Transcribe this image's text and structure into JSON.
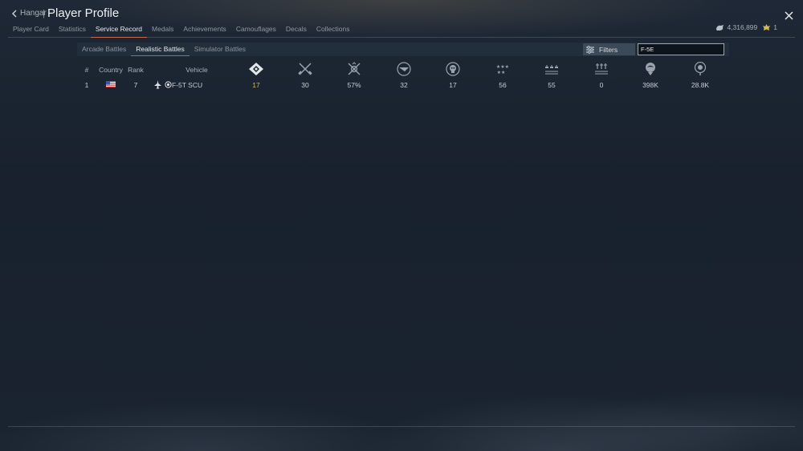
{
  "header": {
    "back_label": "Hangar",
    "separator": "|",
    "title": "Player Profile"
  },
  "tabs": [
    {
      "label": "Player Card"
    },
    {
      "label": "Statistics"
    },
    {
      "label": "Service Record",
      "active": true
    },
    {
      "label": "Medals"
    },
    {
      "label": "Achievements"
    },
    {
      "label": "Camouflages"
    },
    {
      "label": "Decals"
    },
    {
      "label": "Collections"
    }
  ],
  "currency": {
    "silver_lions": "4,316,899",
    "golden_eagles": "1"
  },
  "modes": [
    {
      "label": "Arcade Battles"
    },
    {
      "label": "Realistic Battles",
      "active": true
    },
    {
      "label": "Simulator Battles"
    }
  ],
  "filters": {
    "label": "Filters",
    "search_value": "F-5E"
  },
  "table": {
    "headers": {
      "index": "#",
      "country": "Country",
      "rank": "Rank",
      "vehicle": "Vehicle"
    },
    "stat_icons": [
      "victories-icon",
      "battles-icon",
      "win-rate-icon",
      "respawns-icon",
      "deaths-icon",
      "air-kills-icon",
      "ground-kills-icon",
      "naval-kills-icon",
      "experience-icon",
      "lions-icon"
    ],
    "rows": [
      {
        "index": "1",
        "country": "usa-flag-icon",
        "rank": "7",
        "vehicle_type": "jet-fighter-icon",
        "vehicle_role": "premium-marker-icon",
        "vehicle": "F-5T SCU",
        "stats": [
          "17",
          "30",
          "57%",
          "32",
          "17",
          "56",
          "55",
          "0",
          "398K",
          "28.8K"
        ]
      }
    ]
  },
  "colors": {
    "accent": "#d9542b",
    "gold": "#d8b84f",
    "background": "#1a2330"
  }
}
